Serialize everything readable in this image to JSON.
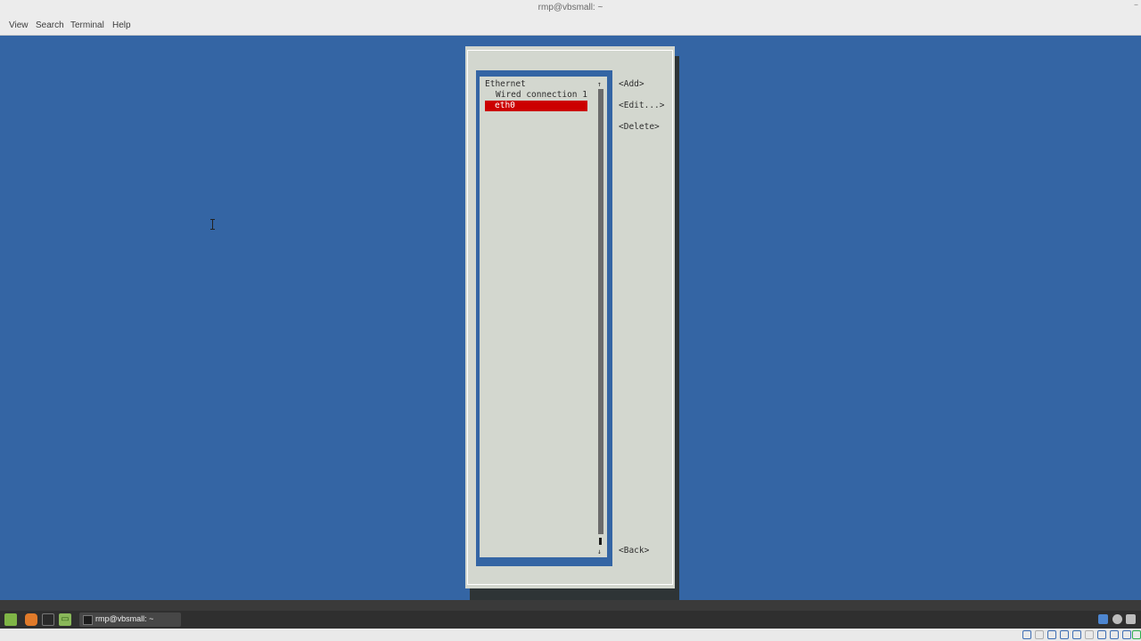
{
  "window": {
    "title": "rmp@vbsmall: ~",
    "title_dash": "–"
  },
  "menubar": {
    "items": [
      "View",
      "Search",
      "Terminal",
      "Help"
    ]
  },
  "nmtui": {
    "list": {
      "scroll_up": "↑",
      "scroll_down": "↓",
      "category": "Ethernet",
      "connections": [
        "Wired connection 1",
        "eth0"
      ],
      "selected": "eth0"
    },
    "buttons": {
      "add": "<Add>",
      "edit": "<Edit...>",
      "delete": "<Delete>",
      "back": "<Back>"
    },
    "colors": {
      "background": "#3465a4",
      "dialog": "#d3d7cf",
      "selection": "#cc0000"
    }
  },
  "taskbar": {
    "window_label": "rmp@vbsmall: ~",
    "launchers": [
      "menu-icon",
      "firefox-icon",
      "terminal-icon",
      "files-icon"
    ],
    "tray": [
      "shield-icon",
      "user-icon",
      "network-icon"
    ]
  },
  "icons": {
    "files": "▭"
  }
}
